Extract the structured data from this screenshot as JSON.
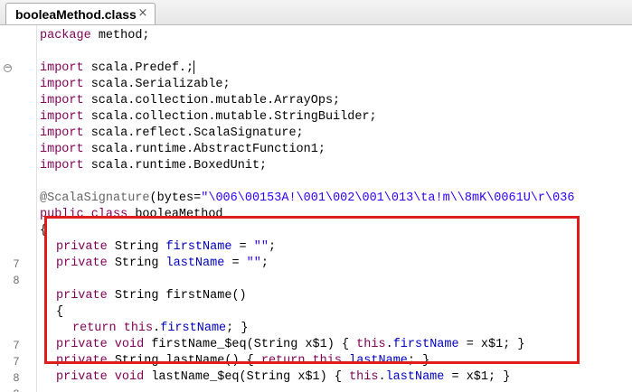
{
  "tab": {
    "title": "booleaMethod.class",
    "close_glyph": "×"
  },
  "colors": {
    "keyword": "#7f0055",
    "field": "#0000c0",
    "string": "#2a00ff",
    "annotation": "#646464",
    "highlight_box": "#e01d1d"
  },
  "lines": {
    "package": {
      "kw": "package",
      "rest": " method;"
    },
    "imports": [
      {
        "kw": "import",
        "rest": " scala.Predef.;"
      },
      {
        "kw": "import",
        "rest": " scala.Serializable;"
      },
      {
        "kw": "import",
        "rest": " scala.collection.mutable.ArrayOps;"
      },
      {
        "kw": "import",
        "rest": " scala.collection.mutable.StringBuilder;"
      },
      {
        "kw": "import",
        "rest": " scala.reflect.ScalaSignature;"
      },
      {
        "kw": "import",
        "rest": " scala.runtime.AbstractFunction1;"
      },
      {
        "kw": "import",
        "rest": " scala.runtime.BoxedUnit;"
      }
    ],
    "annotation": {
      "name": "@ScalaSignature",
      "open": "(bytes=",
      "value": "\"\\006\\00153A!\\001\\002\\001\\013\\ta!m\\\\8mK\\0061U\\r\\036"
    },
    "class_decl": {
      "kw": "public class",
      "rest": " booleaMethod"
    },
    "open_brace": "{",
    "field1": {
      "ln": "7",
      "kw": "private",
      "type": " String ",
      "field": "firstName",
      "eq": " = ",
      "str": "\"\"",
      "end": ";"
    },
    "field2": {
      "ln": "8",
      "kw": "private",
      "type": " String ",
      "field": "lastName",
      "eq": " = ",
      "str": "\"\"",
      "end": ";"
    },
    "getter1_sig": {
      "kw": "private",
      "rest": " String firstName()"
    },
    "getter1_brace": "{",
    "getter1_ret": {
      "ln": "7",
      "kw": "return",
      "sp": " ",
      "kw2": "this",
      "dot": ".",
      "field": "firstName",
      "end": "; }"
    },
    "setter1": {
      "ln": "7",
      "kw": "private void",
      "rest": " firstName_$eq(String x$1) { ",
      "kw2": "this",
      "dot": ".",
      "field": "firstName",
      "end": " = x$1; }"
    },
    "getter2": {
      "ln": "8",
      "kw": "private",
      "rest": " String lastName() { ",
      "kw2": "return this",
      "dot": ".",
      "field": "lastName",
      "end": "; }"
    },
    "setter2": {
      "ln": "8",
      "kw": "private void",
      "rest": " lastName_$eq(String x$1) { ",
      "kw2": "this",
      "dot": ".",
      "field": "lastName",
      "end": " = x$1; }"
    }
  }
}
